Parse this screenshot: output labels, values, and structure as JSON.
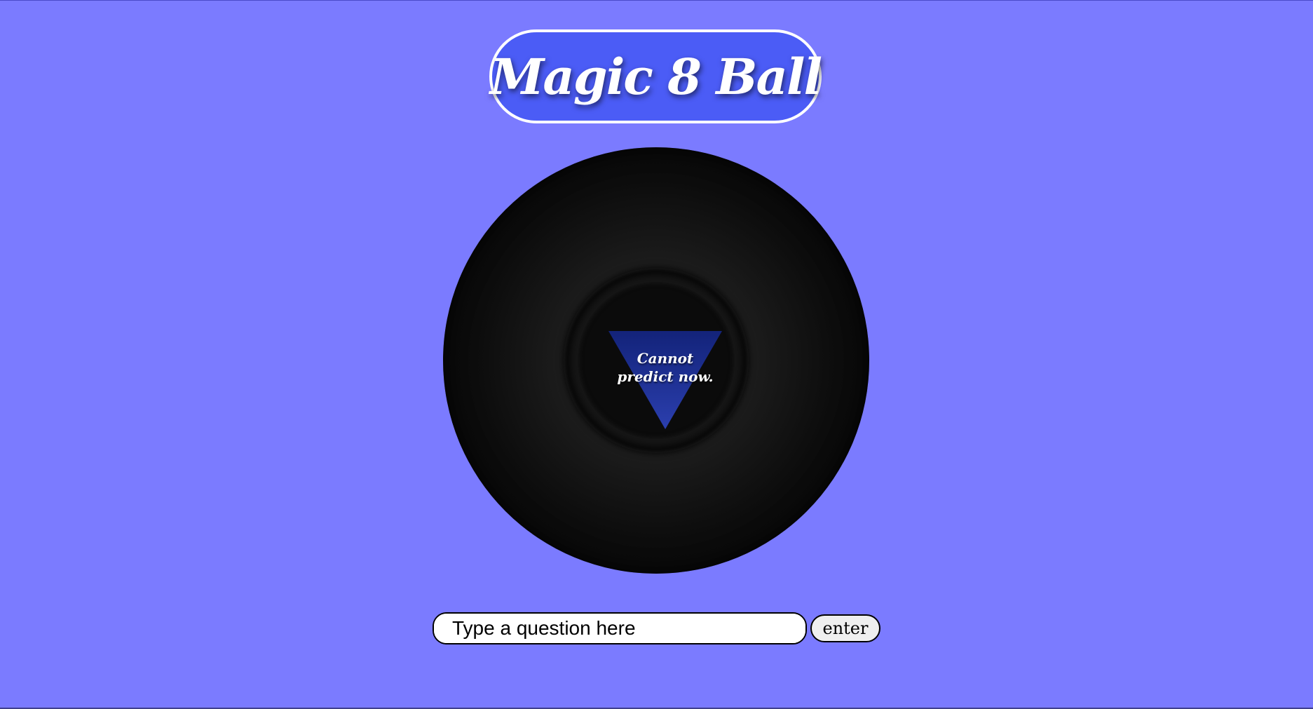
{
  "app": {
    "title": "Magic 8 Ball"
  },
  "ball": {
    "answer": "Cannot\npredict now."
  },
  "question": {
    "value": "Type a question here",
    "placeholder": "Type a question here"
  },
  "enter_button": {
    "label": "enter"
  },
  "colors": {
    "background": "#7b7bff",
    "title_pill": "#4b5cf6",
    "triangle": "#2a3a9c"
  }
}
